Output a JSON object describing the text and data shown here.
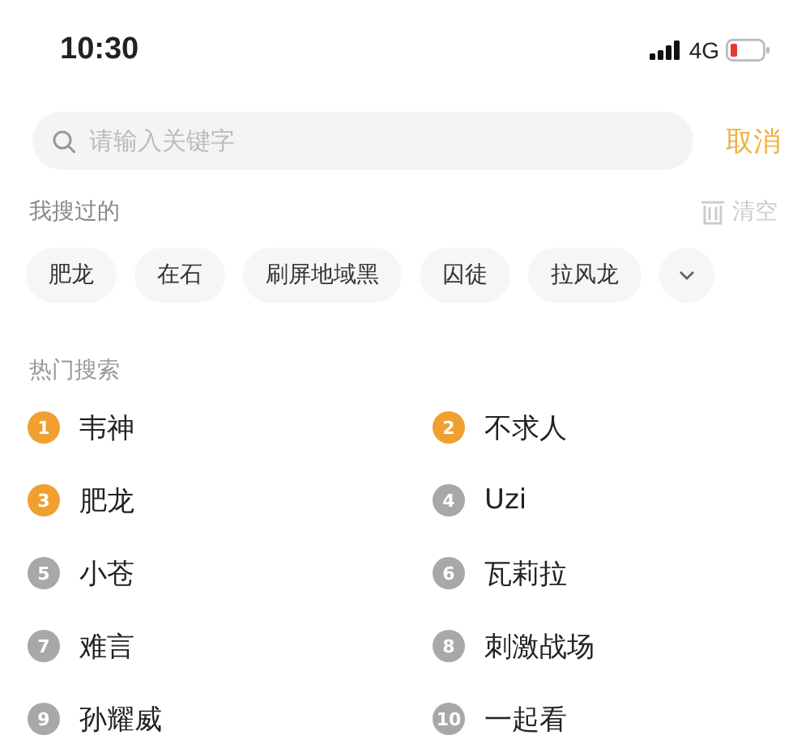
{
  "status_bar": {
    "time": "10:30",
    "network": "4G"
  },
  "search": {
    "placeholder": "请输入关键字",
    "cancel": "取消"
  },
  "history": {
    "title": "我搜过的",
    "clear": "清空",
    "tags": [
      "肥龙",
      "在石",
      "刷屏地域黑",
      "囚徒",
      "拉风龙"
    ]
  },
  "hot": {
    "title": "热门搜索",
    "items": [
      {
        "rank": "1",
        "text": "韦神",
        "color": "#f0a030"
      },
      {
        "rank": "2",
        "text": "不求人",
        "color": "#f0a030"
      },
      {
        "rank": "3",
        "text": "肥龙",
        "color": "#f0a030"
      },
      {
        "rank": "4",
        "text": "Uzi",
        "color": "#a8a8a8"
      },
      {
        "rank": "5",
        "text": "小苍",
        "color": "#a8a8a8"
      },
      {
        "rank": "6",
        "text": "瓦莉拉",
        "color": "#a8a8a8"
      },
      {
        "rank": "7",
        "text": "难言",
        "color": "#a8a8a8"
      },
      {
        "rank": "8",
        "text": "刺激战场",
        "color": "#a8a8a8"
      },
      {
        "rank": "9",
        "text": "孙耀威",
        "color": "#a8a8a8"
      },
      {
        "rank": "10",
        "text": "一起看",
        "color": "#a8a8a8"
      }
    ]
  }
}
